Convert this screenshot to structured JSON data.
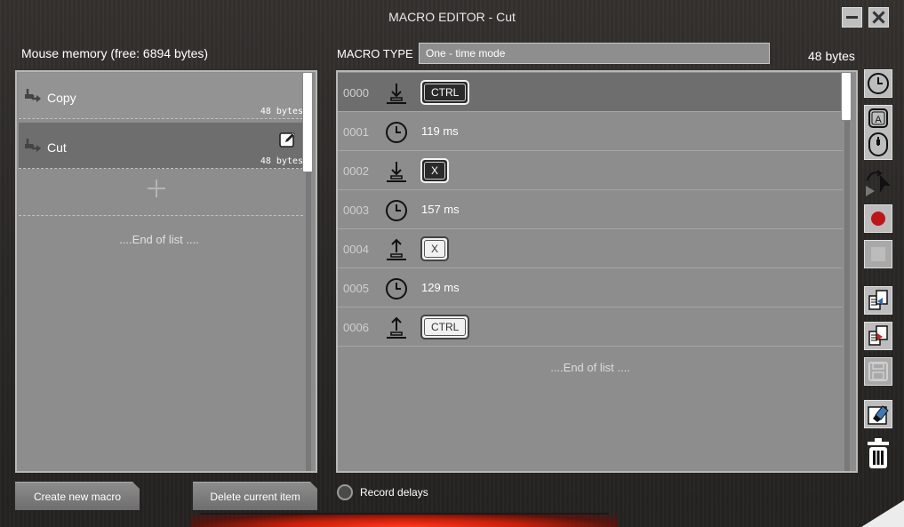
{
  "window": {
    "title": "MACRO EDITOR - Cut",
    "minimize_icon": "minimize-icon",
    "close_icon": "close-icon"
  },
  "memory": {
    "label": "Mouse memory (free: 6894 bytes)"
  },
  "macros": [
    {
      "name": "Copy",
      "size": "48 bytes",
      "icon": "mouse-macro-icon",
      "selected": false
    },
    {
      "name": "Cut",
      "size": "48 bytes",
      "icon": "mouse-macro-icon",
      "selected": true,
      "edit_icon": "edit-icon"
    }
  ],
  "macro_list": {
    "add_icon": "plus-icon",
    "end_text": "....End of list ...."
  },
  "macro_type": {
    "label": "MACRO TYPE",
    "value": "One - time mode"
  },
  "macro_size": "48 bytes",
  "steps": [
    {
      "index": "0000",
      "kind": "key-down",
      "icon": "key-down-icon",
      "key": "CTRL",
      "selected": true
    },
    {
      "index": "0001",
      "kind": "delay",
      "icon": "clock-icon",
      "text": "119 ms"
    },
    {
      "index": "0002",
      "kind": "key-down",
      "icon": "key-down-icon",
      "key": "X"
    },
    {
      "index": "0003",
      "kind": "delay",
      "icon": "clock-icon",
      "text": "157 ms"
    },
    {
      "index": "0004",
      "kind": "key-up",
      "icon": "key-up-icon",
      "key": "X"
    },
    {
      "index": "0005",
      "kind": "delay",
      "icon": "clock-icon",
      "text": "129 ms"
    },
    {
      "index": "0006",
      "kind": "key-up",
      "icon": "key-up-icon",
      "key": "CTRL"
    }
  ],
  "steps_end_text": "....End of list ....",
  "toolbar": [
    {
      "name": "insert-delay-button",
      "icon": "clock-icon"
    },
    {
      "name": "insert-keyboard-mouse-button",
      "icon": "keyboard-mouse-icon"
    },
    {
      "name": "mouse-action-button",
      "icon": "cursor-rotate-icon"
    },
    {
      "name": "record-button",
      "icon": "record-icon"
    },
    {
      "name": "stop-button",
      "icon": "stop-icon"
    },
    {
      "name": "import-button",
      "icon": "import-icon"
    },
    {
      "name": "export-button",
      "icon": "export-icon"
    },
    {
      "name": "save-button",
      "icon": "save-icon"
    },
    {
      "name": "erase-button",
      "icon": "eraser-icon"
    },
    {
      "name": "delete-button",
      "icon": "trash-icon"
    }
  ],
  "buttons": {
    "create": "Create new macro",
    "delete": "Delete current item"
  },
  "record_delays": {
    "label": "Record delays",
    "checked": false
  },
  "colors": {
    "selected_row": "#6e6e6e",
    "panel": "#8d8d8d",
    "record_red": "#c0141a",
    "glow_red": "#ff3a1a"
  }
}
